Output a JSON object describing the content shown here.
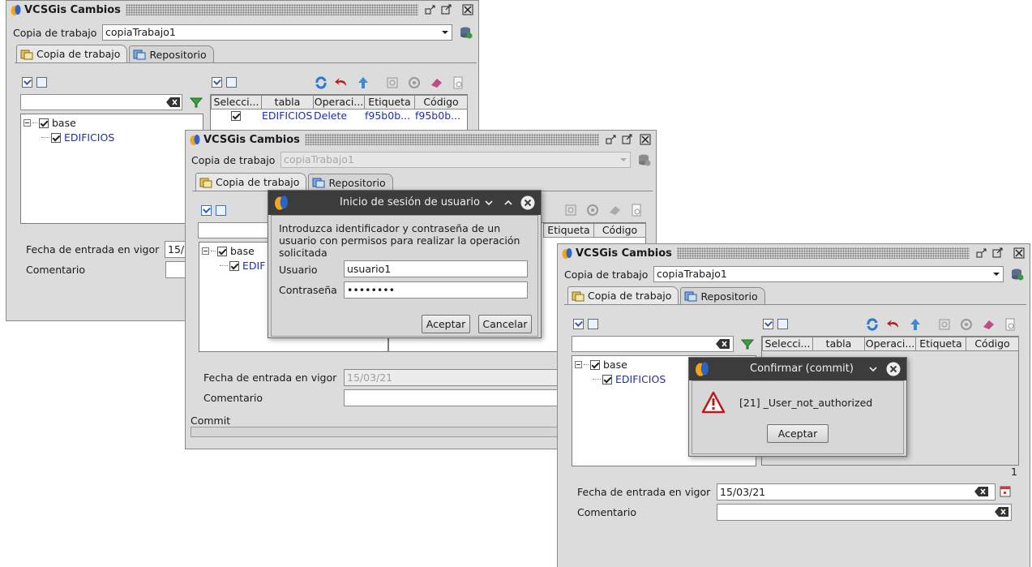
{
  "window": {
    "title": "VCSGis Cambios",
    "working_copy_label": "Copia de trabajo",
    "working_copy_value": "copiaTrabajo1",
    "tabs": [
      "Copia de trabajo",
      "Repositorio"
    ],
    "date_label": "Fecha de entrada en vigor",
    "comment_label": "Comentario",
    "commit_label": "Commit"
  },
  "table": {
    "headers": [
      "Selecci...",
      "tabla",
      "Operaci...",
      "Etiqueta",
      "Código"
    ],
    "rows": [
      {
        "checked": true,
        "tabla": "EDIFICIOS",
        "operacion": "Delete",
        "etiqueta": "f95b0b...",
        "codigo": "f95b0b..."
      }
    ],
    "count": "1"
  },
  "tree": {
    "root": "base",
    "child": "EDIFICIOS"
  },
  "win1": {
    "date_value": "15/"
  },
  "win2": {
    "date_value": "15/03/21",
    "headers_visible": [
      "Etiqueta",
      "Código"
    ],
    "tree_child_partial": "EDIF"
  },
  "win3": {
    "date_value": "15/03/21"
  },
  "login_dialog": {
    "title": "Inicio de sesión de usuario",
    "message_line1": "Introduzca identificador y contraseña de un",
    "message_line2": "usuario con permisos para realizar la operación",
    "message_line3": "solicitada",
    "user_label": "Usuario",
    "user_value": "usuario1",
    "password_label": "Contraseña",
    "password_value": "••••••••",
    "accept": "Aceptar",
    "cancel": "Cancelar"
  },
  "confirm_dialog": {
    "title": "Confirmar (commit)",
    "message": "[21] _User_not_authorized",
    "accept": "Aceptar"
  },
  "colors": {
    "accent_blue": "#1f2fa8",
    "dialog_titlebar": "#3c3c3c",
    "window_bg": "#dcdcdc"
  }
}
